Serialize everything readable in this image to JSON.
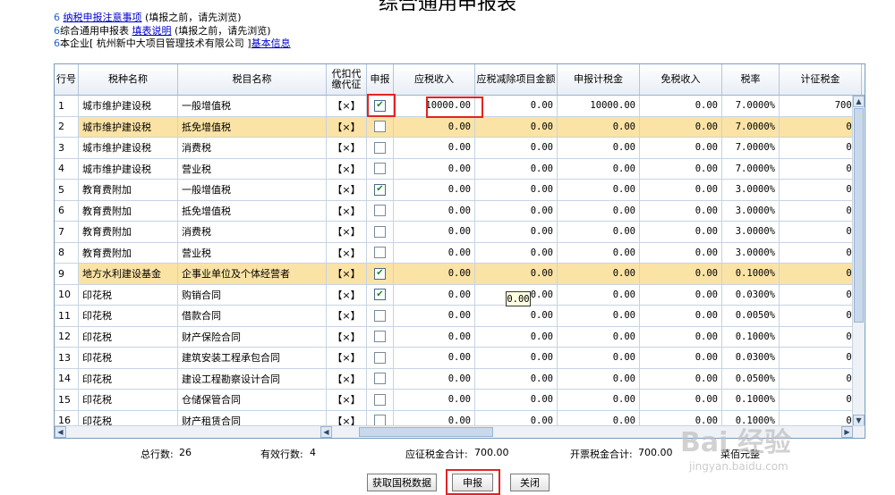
{
  "page": {
    "title": "综合通用申报表",
    "notes": [
      {
        "num": "6",
        "link": "纳税申报注意事项",
        "text": "(填报之前，请先浏览)"
      },
      {
        "num": "6",
        "pre": "综合通用申报表",
        "link": "填表说明",
        "text": "(填报之前，请先浏览)"
      },
      {
        "num": "6",
        "pre": "本企业[ 杭州新中大项目管理技术有限公司 ]",
        "link": "基本信息",
        "text": ""
      }
    ]
  },
  "columns": [
    "行号",
    "税种名称",
    "税目名称",
    "代扣代缴代征",
    "申报",
    "应税收入",
    "应税减除项目金额",
    "申报计税金",
    "免税收入",
    "税率",
    "计征税金"
  ],
  "rows": [
    {
      "no": "1",
      "tax": "城市维护建设税",
      "item": "一般增值税",
      "withhold": "【×】",
      "checked": true,
      "income": "10000.00",
      "deduct": "0.00",
      "base": "10000.00",
      "exempt": "0.00",
      "rate": "7.0000%",
      "levy": "700.",
      "hl": false
    },
    {
      "no": "2",
      "tax": "城市维护建设税",
      "item": "抵免增值税",
      "withhold": "【×】",
      "checked": false,
      "income": "0.00",
      "deduct": "0.00",
      "base": "0.00",
      "exempt": "0.00",
      "rate": "7.0000%",
      "levy": "0.",
      "hl": true
    },
    {
      "no": "3",
      "tax": "城市维护建设税",
      "item": "消费税",
      "withhold": "【×】",
      "checked": false,
      "income": "0.00",
      "deduct": "0.00",
      "base": "0.00",
      "exempt": "0.00",
      "rate": "7.0000%",
      "levy": "0.",
      "hl": false
    },
    {
      "no": "4",
      "tax": "城市维护建设税",
      "item": "营业税",
      "withhold": "【×】",
      "checked": false,
      "income": "0.00",
      "deduct": "0.00",
      "base": "0.00",
      "exempt": "0.00",
      "rate": "7.0000%",
      "levy": "0.",
      "hl": false
    },
    {
      "no": "5",
      "tax": "教育费附加",
      "item": "一般增值税",
      "withhold": "【×】",
      "checked": true,
      "income": "0.00",
      "deduct": "0.00",
      "base": "0.00",
      "exempt": "0.00",
      "rate": "3.0000%",
      "levy": "0.",
      "hl": false
    },
    {
      "no": "6",
      "tax": "教育费附加",
      "item": "抵免增值税",
      "withhold": "【×】",
      "checked": false,
      "income": "0.00",
      "deduct": "0.00",
      "base": "0.00",
      "exempt": "0.00",
      "rate": "3.0000%",
      "levy": "0.",
      "hl": false
    },
    {
      "no": "7",
      "tax": "教育费附加",
      "item": "消费税",
      "withhold": "【×】",
      "checked": false,
      "income": "0.00",
      "deduct": "0.00",
      "base": "0.00",
      "exempt": "0.00",
      "rate": "3.0000%",
      "levy": "0.",
      "hl": false
    },
    {
      "no": "8",
      "tax": "教育费附加",
      "item": "营业税",
      "withhold": "【×】",
      "checked": false,
      "income": "0.00",
      "deduct": "0.00",
      "base": "0.00",
      "exempt": "0.00",
      "rate": "3.0000%",
      "levy": "0.",
      "hl": false
    },
    {
      "no": "9",
      "tax": "地方水利建设基金",
      "item": "企事业单位及个体经营者",
      "withhold": "【×】",
      "checked": true,
      "income": "0.00",
      "deduct": "0.00",
      "base": "0.00",
      "exempt": "0.00",
      "rate": "0.1000%",
      "levy": "0.",
      "hl": true
    },
    {
      "no": "10",
      "tax": "印花税",
      "item": "购销合同",
      "withhold": "【×】",
      "checked": true,
      "income": "0.00",
      "deduct": "0.00",
      "base": "0.00",
      "exempt": "0.00",
      "rate": "0.0300%",
      "levy": "0.",
      "hl": false
    },
    {
      "no": "11",
      "tax": "印花税",
      "item": "借款合同",
      "withhold": "【×】",
      "checked": false,
      "income": "0.00",
      "deduct": "0.00",
      "base": "0.00",
      "exempt": "0.00",
      "rate": "0.0050%",
      "levy": "0.",
      "hl": false
    },
    {
      "no": "12",
      "tax": "印花税",
      "item": "财产保险合同",
      "withhold": "【×】",
      "checked": false,
      "income": "0.00",
      "deduct": "0.00",
      "base": "0.00",
      "exempt": "0.00",
      "rate": "0.1000%",
      "levy": "0.",
      "hl": false
    },
    {
      "no": "13",
      "tax": "印花税",
      "item": "建筑安装工程承包合同",
      "withhold": "【×】",
      "checked": false,
      "income": "0.00",
      "deduct": "0.00",
      "base": "0.00",
      "exempt": "0.00",
      "rate": "0.0300%",
      "levy": "0.",
      "hl": false
    },
    {
      "no": "14",
      "tax": "印花税",
      "item": "建设工程勘察设计合同",
      "withhold": "【×】",
      "checked": false,
      "income": "0.00",
      "deduct": "0.00",
      "base": "0.00",
      "exempt": "0.00",
      "rate": "0.0500%",
      "levy": "0.",
      "hl": false
    },
    {
      "no": "15",
      "tax": "印花税",
      "item": "仓储保管合同",
      "withhold": "【×】",
      "checked": false,
      "income": "0.00",
      "deduct": "0.00",
      "base": "0.00",
      "exempt": "0.00",
      "rate": "0.1000%",
      "levy": "0.",
      "hl": false
    },
    {
      "no": "16",
      "tax": "印花税",
      "item": "财产租赁合同",
      "withhold": "【×】",
      "checked": false,
      "income": "0.00",
      "deduct": "0.00",
      "base": "0.00",
      "exempt": "0.00",
      "rate": "0.1000%",
      "levy": "0.",
      "hl": false
    }
  ],
  "tooltip": "0.00",
  "summary": {
    "total_rows_label": "总行数:",
    "total_rows": "26",
    "valid_rows_label": "有效行数:",
    "valid_rows": "4",
    "tax_total_label": "应征税金合计:",
    "tax_total": "700.00",
    "invoice_total_label": "开票税金合计:",
    "invoice_total": "700.00",
    "unit": "菜佰元整"
  },
  "buttons": {
    "fetch": "获取国税数据",
    "submit": "申报",
    "close": "关闭"
  },
  "watermark": {
    "main": "Bai 经验",
    "sub": "jingyan.baidu.com"
  }
}
